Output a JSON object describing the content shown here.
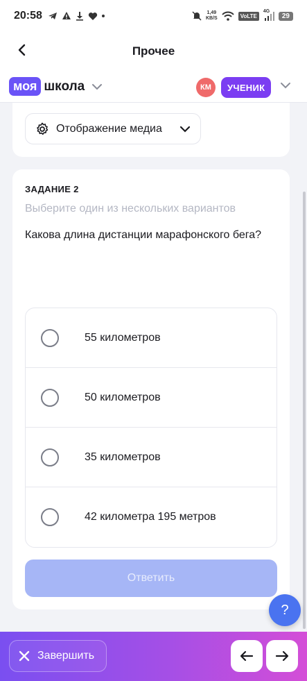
{
  "status_bar": {
    "time": "20:58",
    "speed_top": "1,49",
    "speed_bottom": "KB/S",
    "volte": "VoLTE",
    "network": "4G",
    "battery": "29"
  },
  "topbar": {
    "title": "Прочее"
  },
  "school": {
    "logo_part1": "моя",
    "logo_part2": "школа",
    "avatar_initials": "КМ",
    "role": "УЧЕНИК"
  },
  "media": {
    "label": "Отображение медиа"
  },
  "task": {
    "label": "ЗАДАНИЕ 2",
    "hint": "Выберите один из нескольких вариантов",
    "question": "Какова длина дистанции марафонского бега?",
    "options": [
      "55 километров",
      "50 километров",
      "35 километров",
      "42 километра 195 метров"
    ],
    "submit_label": "Ответить"
  },
  "help": {
    "label": "?"
  },
  "bottom": {
    "finish_label": "Завершить"
  },
  "colors": {
    "brand": "#6a53f7",
    "role_badge": "#7b3df2",
    "submit_disabled": "#a6b6f6",
    "help_fab": "#4a73f0"
  }
}
